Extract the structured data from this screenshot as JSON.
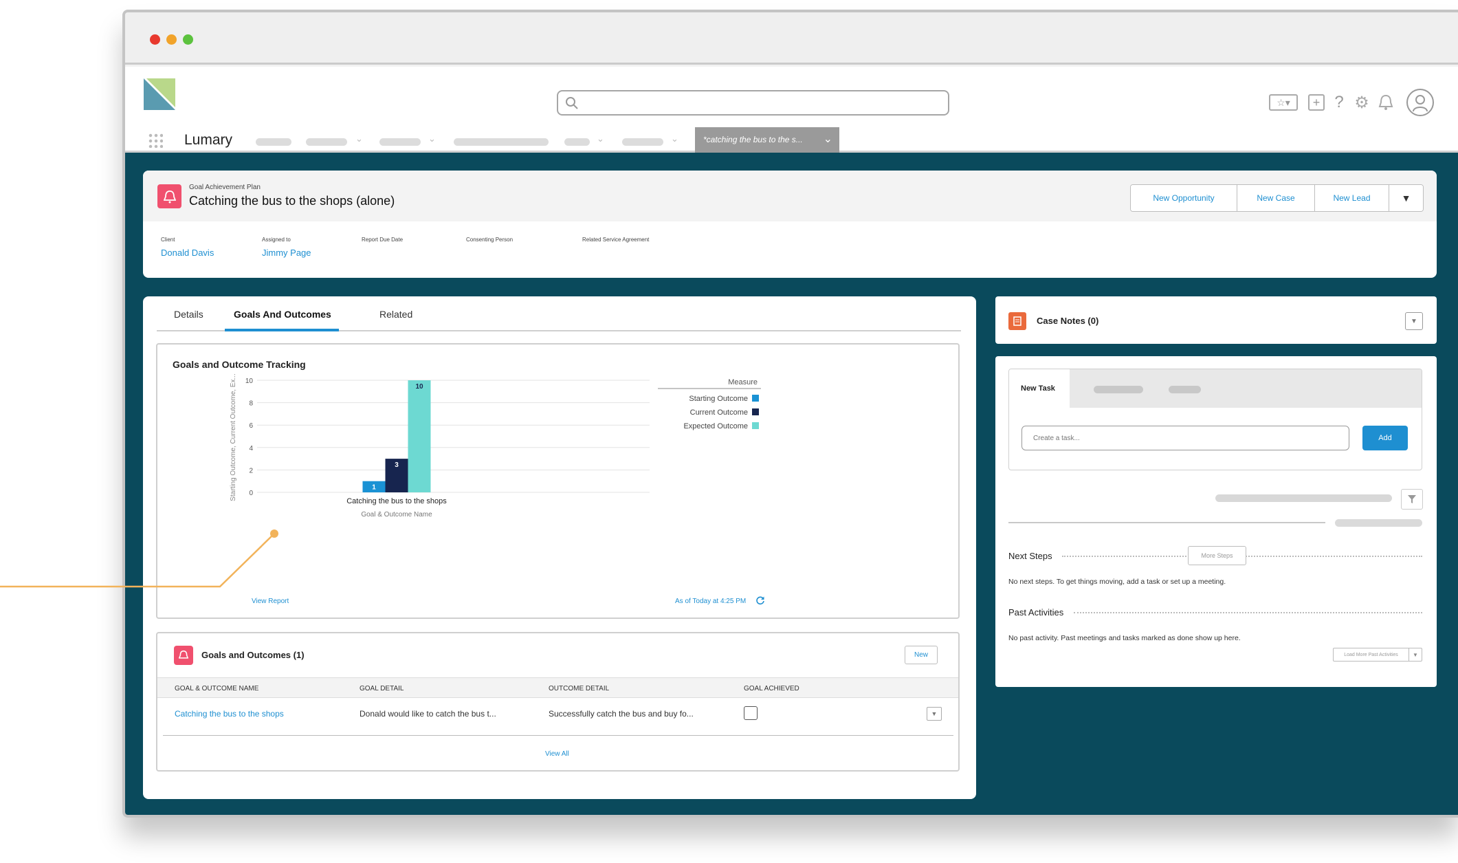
{
  "app": {
    "brand": "Lumary",
    "active_tab": "*catching the bus to the s..."
  },
  "record": {
    "type_label": "Goal Achievement Plan",
    "title": "Catching the bus to the shops (alone)",
    "actions": [
      "New Opportunity",
      "New Case",
      "New Lead"
    ],
    "fields": [
      {
        "label": "Client",
        "value": "Donald Davis"
      },
      {
        "label": "Assigned to",
        "value": "Jimmy Page"
      },
      {
        "label": "Report Due Date",
        "value": ""
      },
      {
        "label": "Consenting Person",
        "value": ""
      },
      {
        "label": "Related Service Agreement",
        "value": ""
      }
    ]
  },
  "tabs": [
    "Details",
    "Goals And Outcomes",
    "Related"
  ],
  "report": {
    "title": "Goals and Outcome Tracking",
    "view_report": "View Report",
    "as_of": "As of Today at 4:25 PM"
  },
  "chart_data": {
    "type": "bar",
    "categories": [
      "Catching the bus to the shops"
    ],
    "series": [
      {
        "name": "Starting Outcome",
        "values": [
          1
        ],
        "color": "#1a92d4"
      },
      {
        "name": "Current Outcome",
        "values": [
          3
        ],
        "color": "#17254f"
      },
      {
        "name": "Expected Outcome",
        "values": [
          10
        ],
        "color": "#6dd9d2"
      }
    ],
    "xlabel": "Goal & Outcome Name",
    "ylabel": "Starting Outcome, Current Outcome, Ex...",
    "legend_title": "Measure",
    "legend_position": "right",
    "yticks": [
      "10",
      "8",
      "6",
      "4",
      "2",
      "0"
    ],
    "ylim": [
      0,
      10
    ],
    "grid": true
  },
  "related_list": {
    "title": "Goals and Outcomes (1)",
    "new_label": "New",
    "columns": [
      "GOAL & OUTCOME NAME",
      "GOAL DETAIL",
      "OUTCOME DETAIL",
      "GOAL ACHIEVED"
    ],
    "rows": [
      {
        "name": "Catching the bus to the shops",
        "goal": "Donald would like to catch the bus t...",
        "outcome": "Successfully catch the bus and buy fo..."
      }
    ],
    "view_all": "View All"
  },
  "case_notes": {
    "title": "Case Notes (0)"
  },
  "activity": {
    "tab": "New Task",
    "placeholder": "Create a task...",
    "add_label": "Add",
    "next_steps_label": "Next Steps",
    "more_steps_label": "More Steps",
    "next_steps_empty": "No next steps. To get things moving, add a task or set up a meeting.",
    "past_label": "Past Activities",
    "past_empty": "No past activity. Past meetings and tasks marked as done show up here.",
    "load_more": "Load More Past Activities"
  },
  "colors": {
    "teal_bg": "#0a4a5c",
    "link": "#1e8fd1",
    "record_icon": "#f0506e",
    "notes_icon": "#ea6a3c",
    "callout": "#f2b35a"
  }
}
